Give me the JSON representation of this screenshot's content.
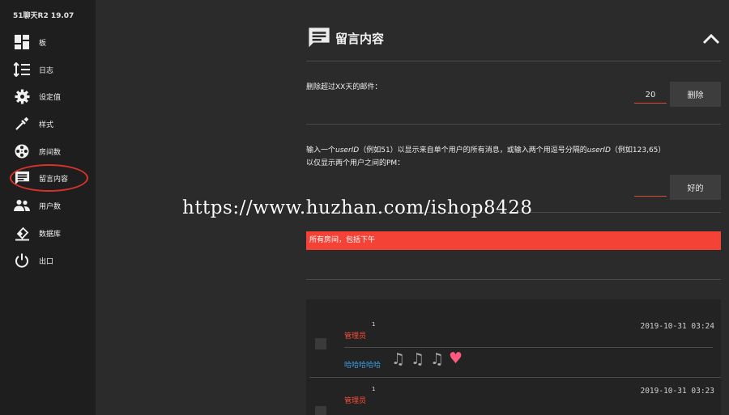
{
  "app": {
    "title": "51聊天R2 19.07"
  },
  "sidebar": {
    "items": [
      {
        "label": "板",
        "icon": "dashboard-icon"
      },
      {
        "label": "日志",
        "icon": "sorted-list-icon"
      },
      {
        "label": "设定值",
        "icon": "gear-icon"
      },
      {
        "label": "样式",
        "icon": "eyedropper-icon"
      },
      {
        "label": "房间数",
        "icon": "film-reel-icon"
      },
      {
        "label": "留言内容",
        "icon": "message-icon",
        "active": true
      },
      {
        "label": "用户数",
        "icon": "users-icon"
      },
      {
        "label": "数据库",
        "icon": "database-erase-icon"
      },
      {
        "label": "出口",
        "icon": "power-icon"
      }
    ]
  },
  "section": {
    "title": "留言内容",
    "icon": "message-icon"
  },
  "delete_form": {
    "label": "删除超过XX天的邮件：",
    "days_value": "20",
    "button_label": "删除"
  },
  "filter_form": {
    "label_line1_a": "输入一个",
    "label_line1_b": "userID",
    "label_line1_c": "（例如51）以显示来自单个用户的所有消息，或输入两个用逗号分隔的",
    "label_line1_d": "userID",
    "label_line1_e": "（例如123,65）",
    "label_line2": "以仅显示两个用户之间的PM：",
    "user_id_value": "",
    "button_label": "好的"
  },
  "room_select": {
    "value": "所有房间，包括下午"
  },
  "messages": [
    {
      "user": "管理员",
      "count": "1",
      "time": "2019-10-31 03:24",
      "text": "哈哈哈哈哈",
      "emojis": [
        "♫",
        "♫",
        "♫",
        "♥"
      ]
    },
    {
      "user": "管理员",
      "count": "1",
      "time": "2019-10-31 03:23"
    }
  ],
  "watermark": "https://www.huzhan.com/ishop8428",
  "colors": {
    "accent_red": "#f44336",
    "link_blue": "#3a9ce0",
    "sidebar_bg": "#1e1e1e",
    "main_bg": "#2b2b2b"
  }
}
